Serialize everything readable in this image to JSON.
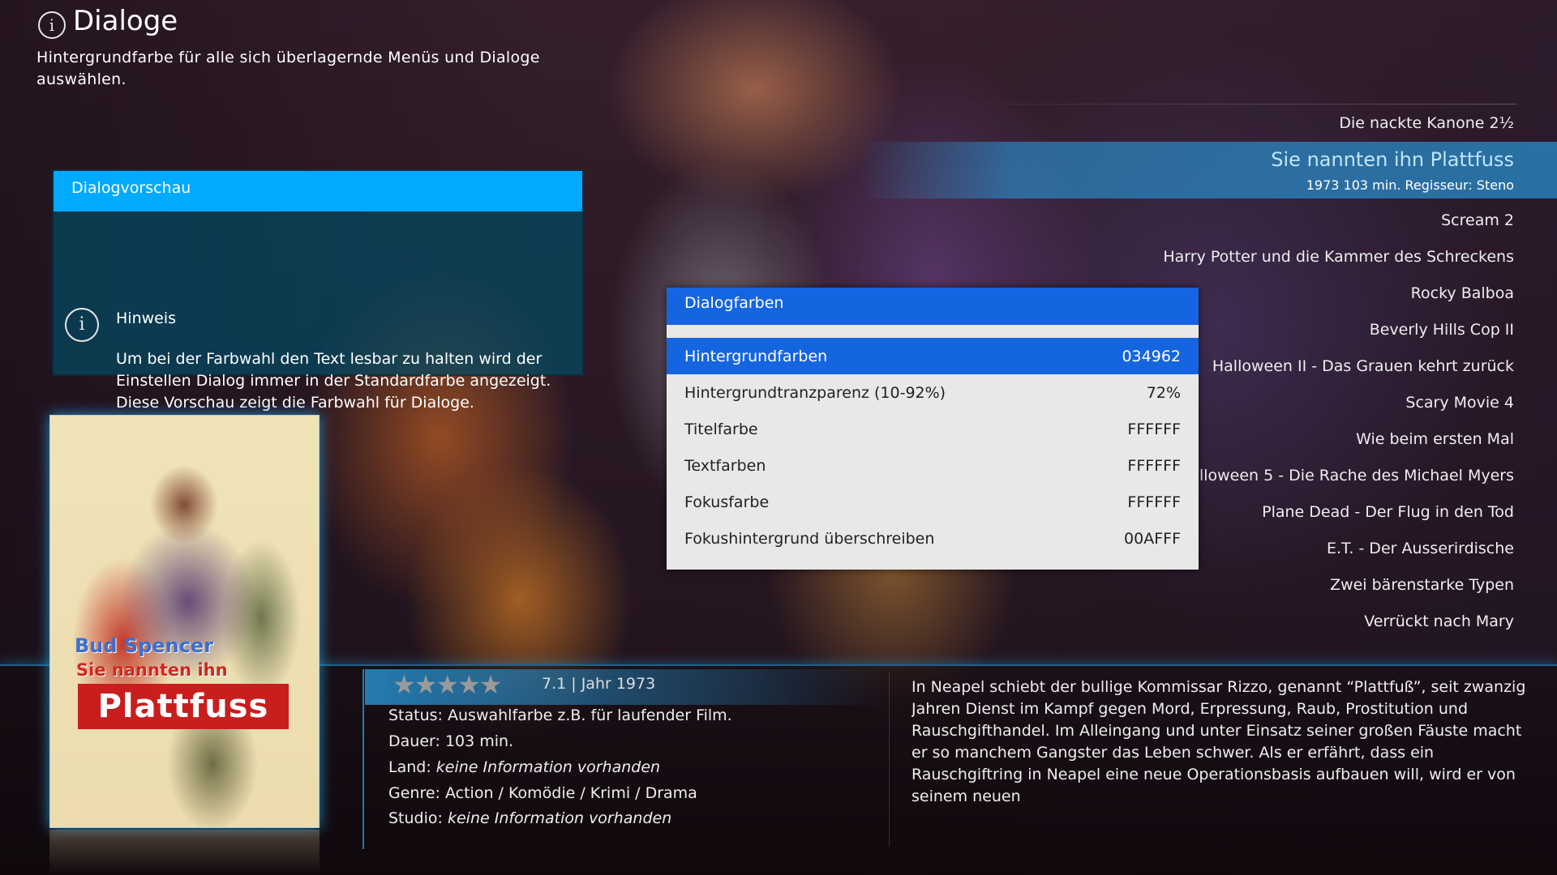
{
  "header": {
    "title": "Dialoge",
    "description": "Hintergrundfarbe für alle sich überlagernde Menüs und Dialoge auswählen."
  },
  "preview": {
    "title": "Dialogvorschau",
    "hint_title": "Hinweis",
    "hint_text": "Um bei der Farbwahl den Text lesbar zu halten wird der Einstellen Dialog immer in der Standardfarbe angezeigt. Diese Vorschau zeigt die Farbwahl für Dialoge."
  },
  "poster": {
    "actor": "Bud Spencer",
    "subtitle": "Sie nannten ihn",
    "logo": "Plattfuss"
  },
  "movie_list": {
    "items": [
      "Die nackte Kanone 2½",
      "Sie nannten ihn Plattfuss",
      "Scream 2",
      "Harry Potter und die Kammer des Schreckens",
      "Rocky Balboa",
      "Beverly Hills Cop II",
      "Halloween II - Das Grauen kehrt zurück",
      "Scary Movie 4",
      "Wie beim ersten Mal",
      "Halloween 5 - Die Rache des Michael Myers",
      "Plane Dead - Der Flug in den Tod",
      "E.T. - Der Ausserirdische",
      "Zwei bärenstarke Typen",
      "Verrückt nach Mary"
    ],
    "focused_index": 1,
    "focused_meta": "1973 103 min.  Regisseur: Steno"
  },
  "dialog": {
    "title": "Dialogfarben",
    "rows": [
      {
        "label": "Hintergrundfarben",
        "value": "034962"
      },
      {
        "label": "Hintergrundtranzparenz (10-92%)",
        "value": "72%"
      },
      {
        "label": "Titelfarbe",
        "value": "FFFFFF"
      },
      {
        "label": "Textfarben",
        "value": "FFFFFF"
      },
      {
        "label": "Fokusfarbe",
        "value": "FFFFFF"
      },
      {
        "label": "Fokushintergrund überschreiben",
        "value": "00AFFF"
      }
    ],
    "focused_index": 0
  },
  "info": {
    "stars": 5,
    "rating_text": "7.1 | Jahr 1973",
    "status_label": "Status:",
    "status_value": "Auswahlfarbe z.B. für laufender Film.",
    "duration_label": "Dauer:",
    "duration_value": "103 min.",
    "country_label": "Land:",
    "country_value": "keine Information vorhanden",
    "genre_label": "Genre:",
    "genre_value": "Action / Komödie / Krimi / Drama",
    "studio_label": "Studio:",
    "studio_value": "keine Information vorhanden"
  },
  "plot": "In Neapel schiebt der bullige Kommissar Rizzo, genannt “Plattfuß”, seit zwanzig Jahren Dienst im Kampf gegen Mord, Erpressung, Raub, Prostitution und Rauschgifthandel. Im Alleingang und unter Einsatz seiner großen Fäuste macht er so manchem Gangster das Leben schwer. Als er erfährt, dass ein Rauschgiftring in Neapel eine neue Operationsbasis aufbauen will, wird er von seinem neuen",
  "colors": {
    "dialog_focus": "#1565e0",
    "preview_header": "#00aaff",
    "preview_background": "#034962",
    "accent": "#28aaf0"
  }
}
